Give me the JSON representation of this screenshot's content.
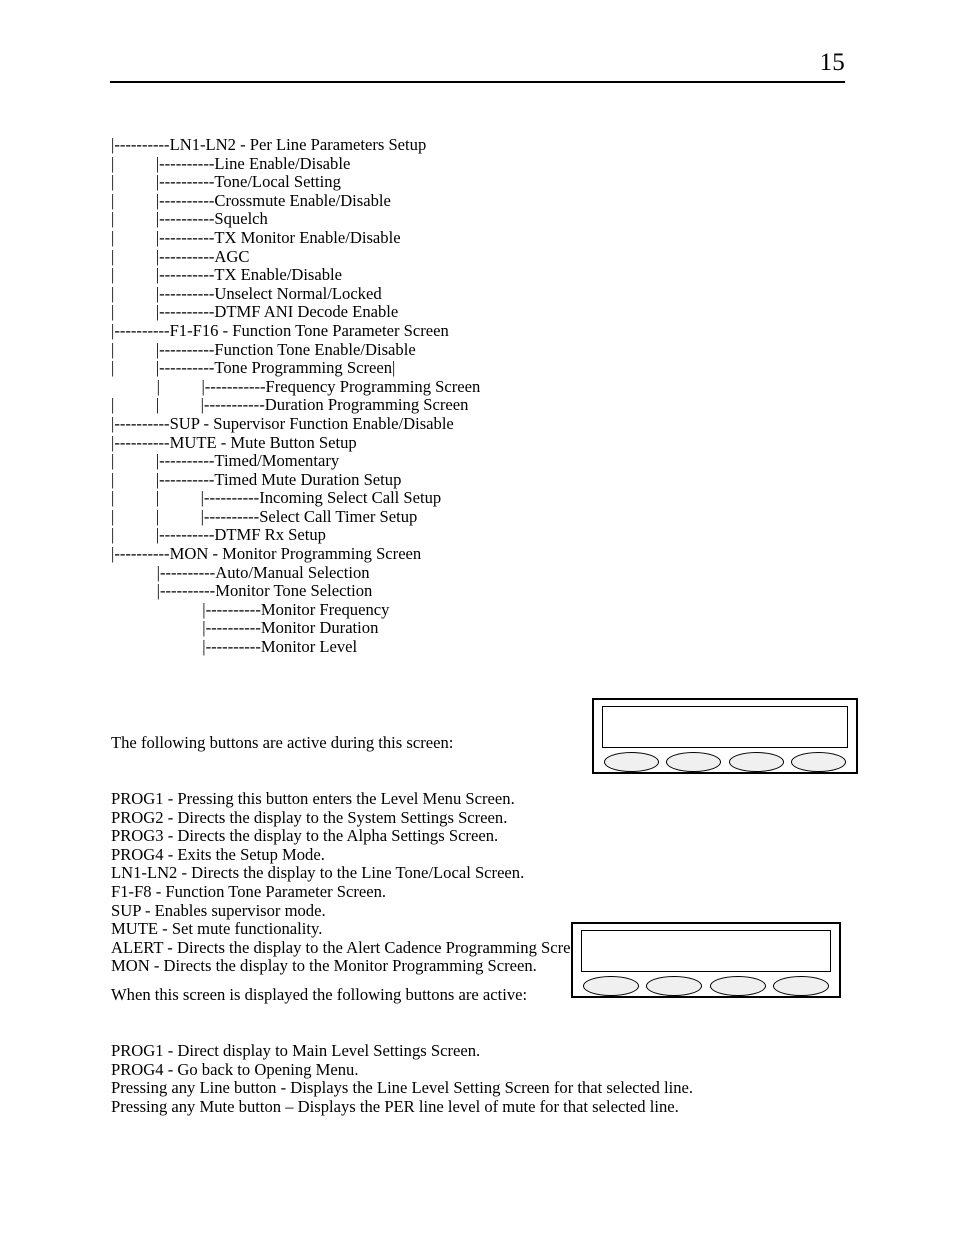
{
  "header": {
    "page_number": "15"
  },
  "menu_tree": {
    "lines": [
      "|----------LN1-LN2 - Per Line Parameters Setup",
      "|          |----------Line Enable/Disable",
      "|          |----------Tone/Local Setting",
      "|          |----------Crossmute Enable/Disable",
      "|          |----------Squelch",
      "|          |----------TX Monitor Enable/Disable",
      "|          |----------AGC",
      "|          |----------TX Enable/Disable",
      "|          |----------Unselect Normal/Locked",
      "|          |----------DTMF ANI Decode Enable",
      "|----------F1-F16 - Function Tone Parameter Screen",
      "|          |----------Function Tone Enable/Disable",
      "|          |----------Tone Programming Screen|",
      "           |          |-----------Frequency Programming Screen",
      "|          |          |-----------Duration Programming Screen",
      "|----------SUP - Supervisor Function Enable/Disable",
      "|----------MUTE - Mute Button Setup",
      "|          |----------Timed/Momentary",
      "|          |----------Timed Mute Duration Setup",
      "|          |          |----------Incoming Select Call Setup",
      "|          |          |----------Select Call Timer Setup",
      "|          |----------DTMF Rx Setup",
      "|----------MON - Monitor Programming Screen",
      "           |----------Auto/Manual Selection",
      "           |----------Monitor Tone Selection",
      "                      |----------Monitor Frequency",
      "                      |----------Monitor Duration",
      "                      |----------Monitor Level"
    ]
  },
  "setup_screen_buttons": {
    "intro": "The following buttons are active during this screen:",
    "lines": [
      "PROG1 - Pressing this button enters the Level Menu Screen.",
      "PROG2 - Directs the display to the System Settings Screen.",
      "PROG3 - Directs the display to the Alpha Settings Screen.",
      "PROG4 - Exits the Setup Mode.",
      "LN1-LN2 - Directs the display to the Line Tone/Local Screen.",
      "F1-F8 - Function Tone Parameter Screen.",
      "SUP - Enables supervisor mode.",
      "MUTE - Set mute functionality.",
      "ALERT - Directs the display to the Alert Cadence Programming Screen.",
      "MON - Directs the display to the Monitor Programming Screen."
    ]
  },
  "level_screen_buttons": {
    "intro": "When this screen is displayed the following buttons are active:",
    "lines": [
      "PROG1 - Direct display to Main Level Settings Screen.",
      "PROG4 - Go back to Opening Menu.",
      "Pressing any Line button - Displays the Line Level Setting Screen for that selected line.",
      "Pressing any Mute button – Displays the PER line level of mute for that selected line."
    ]
  },
  "devices": {
    "setup_console": {
      "display_text": "",
      "button_count": 4
    },
    "level_console": {
      "display_text": "",
      "button_count": 4
    }
  },
  "colors": {
    "text": "#000000",
    "page_background": "#ffffff",
    "button_fill": "#f0f0f0",
    "border": "#000000"
  }
}
